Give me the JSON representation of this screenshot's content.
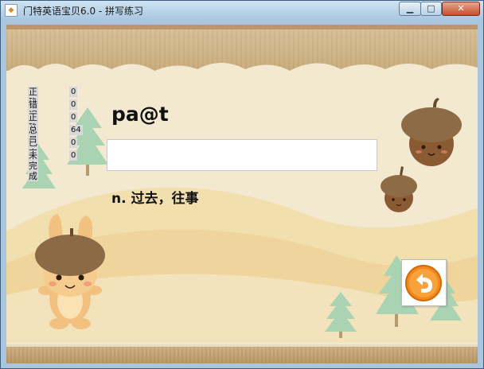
{
  "window": {
    "title": "门特英语宝贝6.0 - 拼写练习",
    "icon": "app-icon",
    "controls": [
      "minimize-icon",
      "maximize-icon",
      "close-icon"
    ]
  },
  "stats": [
    {
      "label": "正确",
      "value": "0"
    },
    {
      "label": "错误",
      "value": "0"
    },
    {
      "label": "正确率",
      "value": "0"
    },
    {
      "label": "总量",
      "value": "64"
    },
    {
      "label": "已完成",
      "value": "0"
    },
    {
      "label": "未完成",
      "value": "0"
    }
  ],
  "exercise": {
    "word": "pa@t",
    "answer_value": "",
    "meaning": "n. 过去，往事"
  },
  "back_button": {
    "icon": "return-arrow-icon"
  },
  "colors": {
    "title_bar": "#a8c7e1",
    "background": "#f3e9d1",
    "band": "#c9ad7f",
    "back_button_orange": "#f08a1c"
  }
}
